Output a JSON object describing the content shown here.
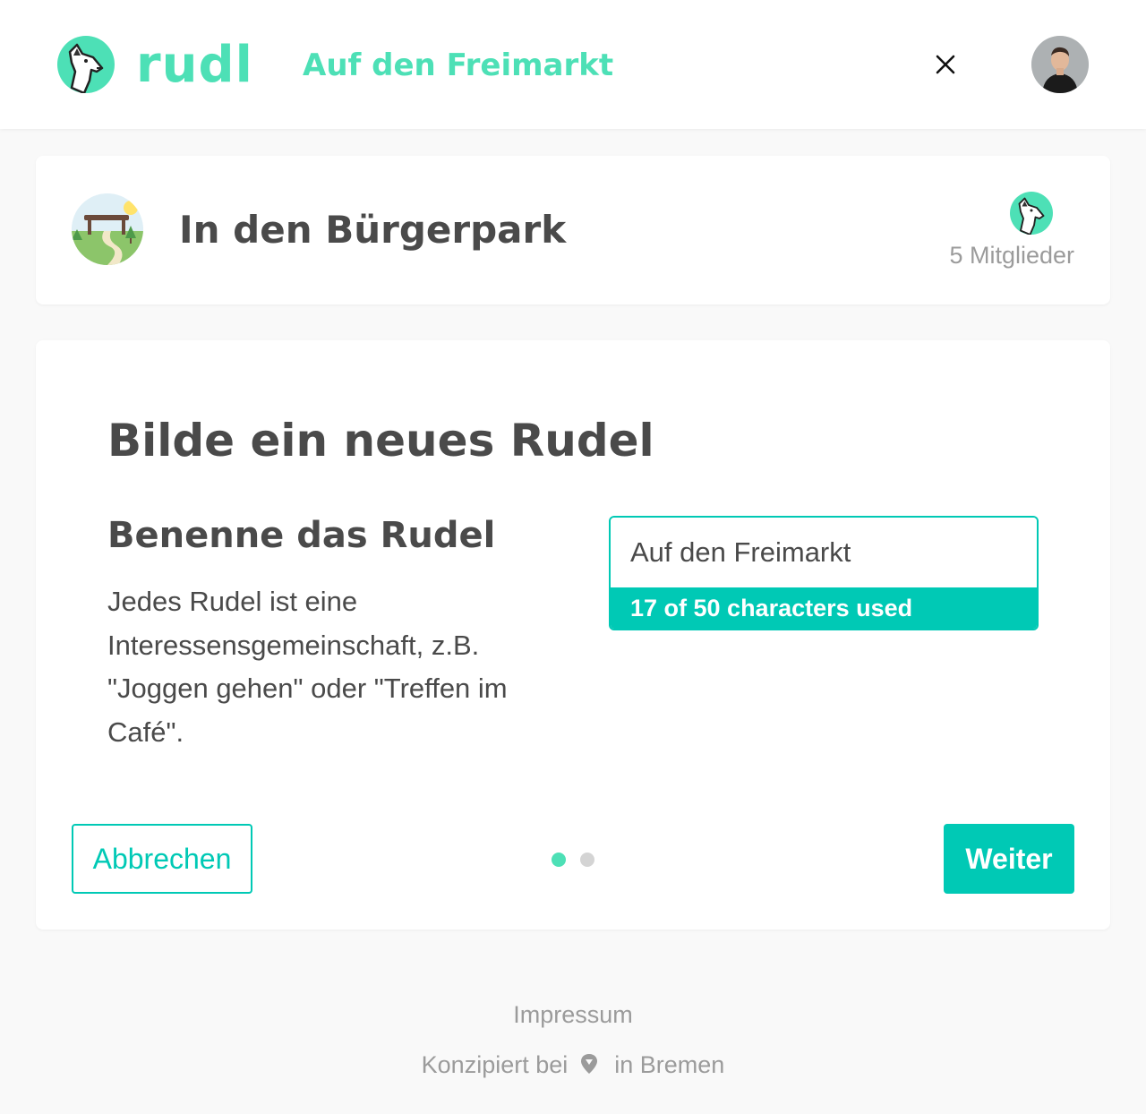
{
  "header": {
    "brand": "rudl",
    "title": "Auf den Freimarkt",
    "close_icon": "close-icon",
    "brand_color": "#4de0b6"
  },
  "group": {
    "name": "In den Bürgerpark",
    "members_label": "5 Mitglieder"
  },
  "form": {
    "title": "Bilde ein neues Rudel",
    "step_title": "Benenne das Rudel",
    "step_description": "Jedes Rudel ist eine Interessensgemeinschaft, z.B. \"Joggen gehen\" oder \"Treffen im Café\".",
    "name_value": "Auf den Freimarkt",
    "char_counter": "17 of 50 characters used",
    "accent_color": "#00c9b5",
    "pager": {
      "current_step": 1,
      "total_steps": 2
    },
    "cancel_label": "Abbrechen",
    "next_label": "Weiter"
  },
  "footer": {
    "impressum": "Impressum",
    "credit_prefix": "Konzipiert bei",
    "credit_suffix": "in Bremen",
    "pin_icon": "map-pin-icon"
  }
}
